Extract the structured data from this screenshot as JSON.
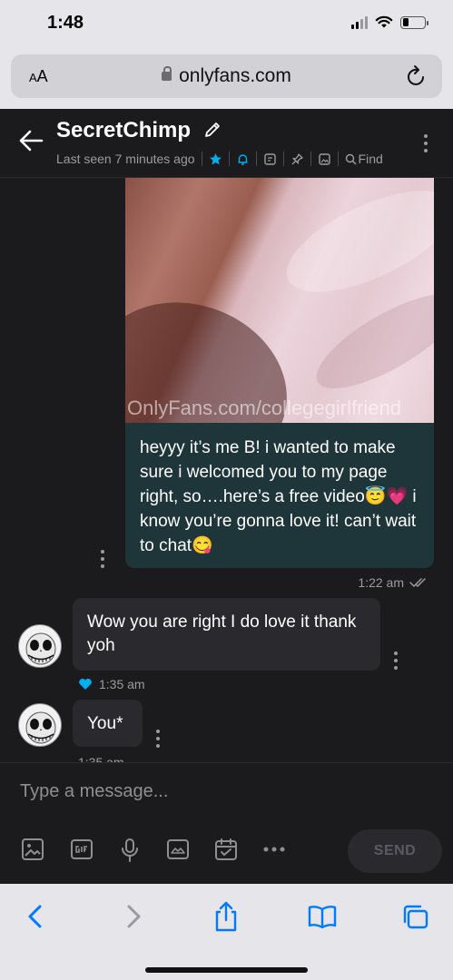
{
  "status_bar": {
    "time": "1:48"
  },
  "browser": {
    "text_size_button": "AA",
    "url": "onlyfans.com"
  },
  "chat": {
    "name": "SecretChimp",
    "last_seen": "Last seen 7 minutes ago",
    "find_label": "Find"
  },
  "messages": {
    "media_watermark": "OnlyFans.com/collegegirlfriend",
    "sent_text": "heyyy it’s me B! i wanted to make sure i welcomed you to my page right, so….here’s a free video😇💗 i know you’re gonna love it! can’t wait to chat😋",
    "sent_time": "1:22 am",
    "received": [
      {
        "text": "Wow you are right I do love it thank yoh",
        "time": "1:35 am",
        "liked": true
      },
      {
        "text": "You*",
        "time": "1:35 am",
        "liked": false
      }
    ]
  },
  "compose": {
    "placeholder": "Type a message...",
    "send_label": "SEND"
  },
  "colors": {
    "accent": "#00aff0",
    "sent_bubble": "#1e353a",
    "received_bubble": "#2a2a2e",
    "background": "#1b1b1d",
    "browser_chrome": "#e5e5ea",
    "safari_blue": "#007aff"
  }
}
